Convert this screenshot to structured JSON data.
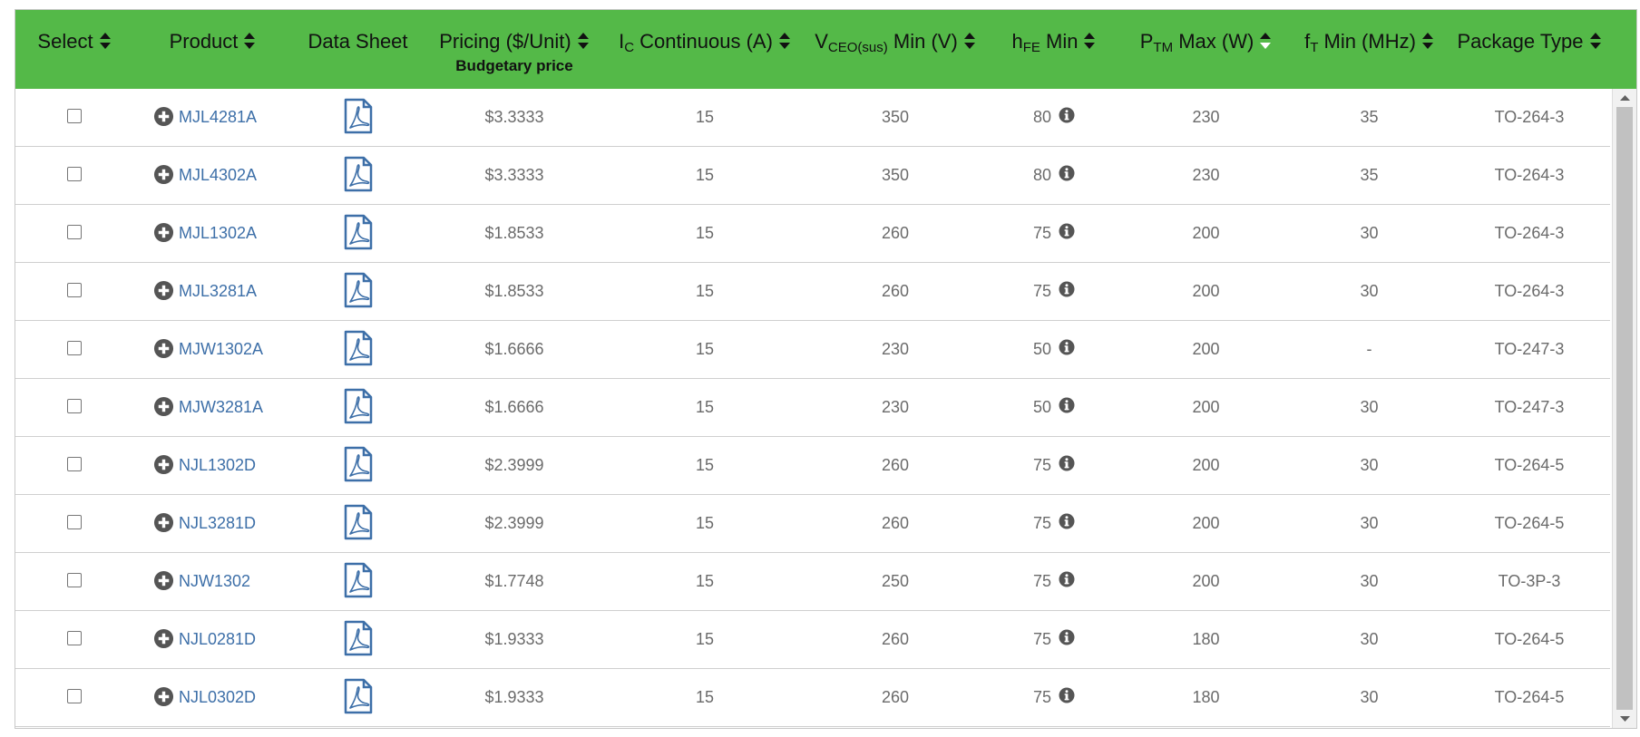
{
  "columns": [
    {
      "label_html": "Select",
      "sortable": true
    },
    {
      "label_html": "Product",
      "sortable": true
    },
    {
      "label_html": "Data Sheet",
      "sortable": false
    },
    {
      "label_html": "Pricing ($/Unit)",
      "sub": "Budgetary price",
      "sortable": true
    },
    {
      "label_html": "I<sub>C</sub> Continuous (A)",
      "sortable": true
    },
    {
      "label_html": "V<sub>CEO(sus)</sub> Min (V)",
      "sortable": true
    },
    {
      "label_html": "h<sub>FE</sub> Min",
      "sortable": true
    },
    {
      "label_html": "P<sub>TM</sub> Max (W)",
      "sortable": true,
      "active_desc": true
    },
    {
      "label_html": "f<sub>T</sub> Min (MHz)",
      "sortable": true
    },
    {
      "label_html": "Package Type",
      "sortable": true
    }
  ],
  "rows": [
    {
      "product": "MJL4281A",
      "price": "$3.3333",
      "ic": "15",
      "vceo": "350",
      "hfe": "80",
      "ptm": "230",
      "ft": "35",
      "package": "TO-264-3"
    },
    {
      "product": "MJL4302A",
      "price": "$3.3333",
      "ic": "15",
      "vceo": "350",
      "hfe": "80",
      "ptm": "230",
      "ft": "35",
      "package": "TO-264-3"
    },
    {
      "product": "MJL1302A",
      "price": "$1.8533",
      "ic": "15",
      "vceo": "260",
      "hfe": "75",
      "ptm": "200",
      "ft": "30",
      "package": "TO-264-3"
    },
    {
      "product": "MJL3281A",
      "price": "$1.8533",
      "ic": "15",
      "vceo": "260",
      "hfe": "75",
      "ptm": "200",
      "ft": "30",
      "package": "TO-264-3"
    },
    {
      "product": "MJW1302A",
      "price": "$1.6666",
      "ic": "15",
      "vceo": "230",
      "hfe": "50",
      "ptm": "200",
      "ft": "-",
      "package": "TO-247-3"
    },
    {
      "product": "MJW3281A",
      "price": "$1.6666",
      "ic": "15",
      "vceo": "230",
      "hfe": "50",
      "ptm": "200",
      "ft": "30",
      "package": "TO-247-3"
    },
    {
      "product": "NJL1302D",
      "price": "$2.3999",
      "ic": "15",
      "vceo": "260",
      "hfe": "75",
      "ptm": "200",
      "ft": "30",
      "package": "TO-264-5"
    },
    {
      "product": "NJL3281D",
      "price": "$2.3999",
      "ic": "15",
      "vceo": "260",
      "hfe": "75",
      "ptm": "200",
      "ft": "30",
      "package": "TO-264-5"
    },
    {
      "product": "NJW1302",
      "price": "$1.7748",
      "ic": "15",
      "vceo": "250",
      "hfe": "75",
      "ptm": "200",
      "ft": "30",
      "package": "TO-3P-3"
    },
    {
      "product": "NJL0281D",
      "price": "$1.9333",
      "ic": "15",
      "vceo": "260",
      "hfe": "75",
      "ptm": "180",
      "ft": "30",
      "package": "TO-264-5"
    },
    {
      "product": "NJL0302D",
      "price": "$1.9333",
      "ic": "15",
      "vceo": "260",
      "hfe": "75",
      "ptm": "180",
      "ft": "30",
      "package": "TO-264-5"
    }
  ],
  "icons": {
    "sort": "sort-icon",
    "expand": "plus-circle-icon",
    "datasheet": "pdf-icon",
    "info": "info-icon"
  },
  "colors": {
    "header_bg": "#54b948",
    "link": "#3d6fa8",
    "text": "#6a6a6a"
  }
}
